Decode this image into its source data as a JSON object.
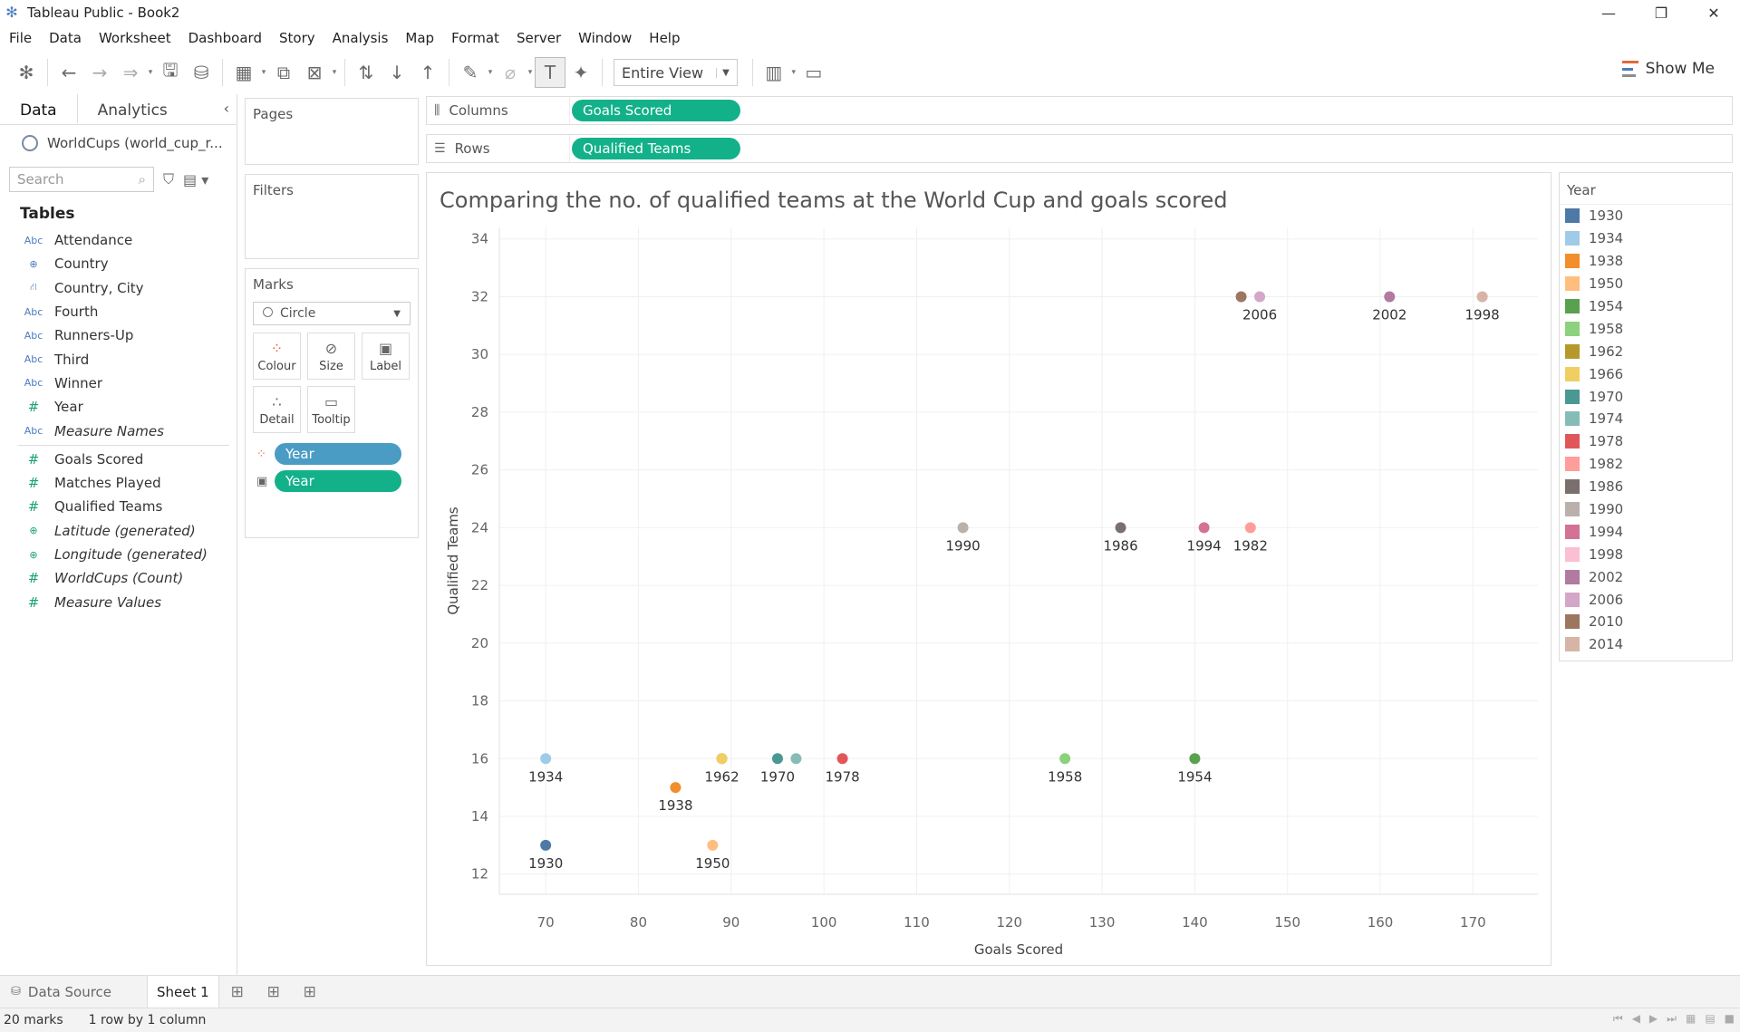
{
  "window": {
    "title": "Tableau Public - Book2"
  },
  "menu": [
    "File",
    "Data",
    "Worksheet",
    "Dashboard",
    "Story",
    "Analysis",
    "Map",
    "Format",
    "Server",
    "Window",
    "Help"
  ],
  "toolbar": {
    "fit_select": "Entire View",
    "show_me": "Show Me"
  },
  "data_pane": {
    "tab_data": "Data",
    "tab_analytics": "Analytics",
    "datasource": "WorldCups (world_cup_r...",
    "search_placeholder": "Search",
    "tables_heading": "Tables",
    "dimensions": [
      {
        "type": "Abc",
        "name": "Attendance"
      },
      {
        "type": "globe",
        "name": "Country"
      },
      {
        "type": "hier",
        "name": "Country, City"
      },
      {
        "type": "Abc",
        "name": "Fourth"
      },
      {
        "type": "Abc",
        "name": "Runners-Up"
      },
      {
        "type": "Abc",
        "name": "Third"
      },
      {
        "type": "Abc",
        "name": "Winner"
      },
      {
        "type": "#",
        "name": "Year"
      },
      {
        "type": "Abc",
        "name": "Measure Names"
      }
    ],
    "measures": [
      {
        "type": "#",
        "name": "Goals Scored"
      },
      {
        "type": "#",
        "name": "Matches Played"
      },
      {
        "type": "#",
        "name": "Qualified Teams"
      },
      {
        "type": "globe",
        "name": "Latitude (generated)"
      },
      {
        "type": "globe",
        "name": "Longitude (generated)"
      },
      {
        "type": "#",
        "name": "WorldCups (Count)"
      },
      {
        "type": "#",
        "name": "Measure Values"
      }
    ]
  },
  "shelves": {
    "pages_label": "Pages",
    "filters_label": "Filters",
    "marks_label": "Marks",
    "mark_type": "Circle",
    "mark_buttons": [
      "Colour",
      "Size",
      "Label",
      "Detail",
      "Tooltip"
    ],
    "mark_pills": [
      "Year",
      "Year"
    ],
    "columns_label": "Columns",
    "rows_label": "Rows",
    "columns_pill": "Goals Scored",
    "rows_pill": "Qualified Teams"
  },
  "legend": {
    "title": "Year",
    "items": [
      {
        "label": "1930",
        "color": "#4e79a7"
      },
      {
        "label": "1934",
        "color": "#a0cbe8"
      },
      {
        "label": "1938",
        "color": "#f28e2b"
      },
      {
        "label": "1950",
        "color": "#ffbe7d"
      },
      {
        "label": "1954",
        "color": "#59a14f"
      },
      {
        "label": "1958",
        "color": "#8cd17d"
      },
      {
        "label": "1962",
        "color": "#b6992d"
      },
      {
        "label": "1966",
        "color": "#f1ce63"
      },
      {
        "label": "1970",
        "color": "#499894"
      },
      {
        "label": "1974",
        "color": "#86bcb6"
      },
      {
        "label": "1978",
        "color": "#e15759"
      },
      {
        "label": "1982",
        "color": "#ff9d9a"
      },
      {
        "label": "1986",
        "color": "#79706e"
      },
      {
        "label": "1990",
        "color": "#bab0ac"
      },
      {
        "label": "1994",
        "color": "#d37295"
      },
      {
        "label": "1998",
        "color": "#fabfd2"
      },
      {
        "label": "2002",
        "color": "#b07aa1"
      },
      {
        "label": "2006",
        "color": "#d4a6c8"
      },
      {
        "label": "2010",
        "color": "#9d7660"
      },
      {
        "label": "2014",
        "color": "#d7b5a6"
      }
    ]
  },
  "chart_data": {
    "type": "scatter",
    "title": "Comparing the no. of qualified teams at the World Cup and goals scored",
    "xlabel": "Goals Scored",
    "ylabel": "Qualified Teams",
    "xlim": [
      65,
      177
    ],
    "ylim": [
      11.3,
      34.4
    ],
    "xticks": [
      70,
      80,
      90,
      100,
      110,
      120,
      130,
      140,
      150,
      160,
      170
    ],
    "yticks": [
      12,
      14,
      16,
      18,
      20,
      22,
      24,
      26,
      28,
      30,
      32,
      34
    ],
    "grid": true,
    "points": [
      {
        "year": "1930",
        "x": 70,
        "y": 13,
        "color": "#4e79a7",
        "label": "1930"
      },
      {
        "year": "1934",
        "x": 70,
        "y": 16,
        "color": "#a0cbe8",
        "label": "1934"
      },
      {
        "year": "1938",
        "x": 84,
        "y": 15,
        "color": "#f28e2b",
        "label": "1938"
      },
      {
        "year": "1950",
        "x": 88,
        "y": 13,
        "color": "#ffbe7d",
        "label": "1950"
      },
      {
        "year": "1954",
        "x": 140,
        "y": 16,
        "color": "#59a14f",
        "label": "1954"
      },
      {
        "year": "1958",
        "x": 126,
        "y": 16,
        "color": "#8cd17d",
        "label": "1958"
      },
      {
        "year": "1962",
        "x": 89,
        "y": 16,
        "color": "#b6992d",
        "label": "1962"
      },
      {
        "year": "1966",
        "x": 89,
        "y": 16,
        "color": "#f1ce63",
        "label": ""
      },
      {
        "year": "1970",
        "x": 95,
        "y": 16,
        "color": "#499894",
        "label": "1970"
      },
      {
        "year": "1974",
        "x": 97,
        "y": 16,
        "color": "#86bcb6",
        "label": ""
      },
      {
        "year": "1978",
        "x": 102,
        "y": 16,
        "color": "#e15759",
        "label": "1978"
      },
      {
        "year": "1982",
        "x": 146,
        "y": 24,
        "color": "#ff9d9a",
        "label": "1982"
      },
      {
        "year": "1986",
        "x": 132,
        "y": 24,
        "color": "#79706e",
        "label": "1986"
      },
      {
        "year": "1990",
        "x": 115,
        "y": 24,
        "color": "#bab0ac",
        "label": "1990"
      },
      {
        "year": "1994",
        "x": 141,
        "y": 24,
        "color": "#d37295",
        "label": "1994"
      },
      {
        "year": "1998",
        "x": 171,
        "y": 32,
        "color": "#fabfd2",
        "label": "1998"
      },
      {
        "year": "2002",
        "x": 161,
        "y": 32,
        "color": "#b07aa1",
        "label": "2002"
      },
      {
        "year": "2006",
        "x": 147,
        "y": 32,
        "color": "#d4a6c8",
        "label": "2006"
      },
      {
        "year": "2010",
        "x": 145,
        "y": 32,
        "color": "#9d7660",
        "label": ""
      },
      {
        "year": "2014",
        "x": 171,
        "y": 32,
        "color": "#d7b5a6",
        "label": ""
      }
    ]
  },
  "sheet_tabs": {
    "data_source": "Data Source",
    "sheet": "Sheet 1"
  },
  "status": {
    "marks": "20 marks",
    "dims": "1 row by 1 column"
  }
}
